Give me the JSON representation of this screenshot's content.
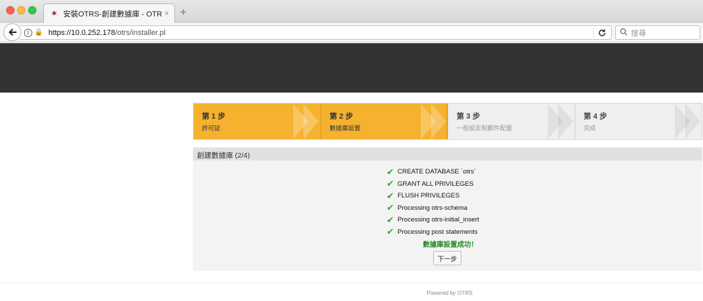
{
  "browser": {
    "tab_title": "安裝OTRS-創建數據庫 - OTRS",
    "tab_close": "×",
    "new_tab": "+",
    "url_host": "https://10.0.252.178",
    "url_path": "/otrs/installer.pl",
    "search_placeholder": "搜尋"
  },
  "wizard": {
    "steps": [
      {
        "num": "第 1 步",
        "label": "許可証",
        "state": "done"
      },
      {
        "num": "第 2 步",
        "label": "數據庫設置",
        "state": "active"
      },
      {
        "num": "第 3 步",
        "label": "一般設定和郵件配置",
        "state": "todo"
      },
      {
        "num": "第 4 步",
        "label": "完成",
        "state": "todo"
      }
    ]
  },
  "panel": {
    "title": "創建數據庫 (2/4)",
    "checklist": [
      "CREATE DATABASE `otrs`",
      "GRANT ALL PRIVILEGES",
      "FLUSH PRIVILEGES",
      "Processing otrs-schema",
      "Processing otrs-initial_insert",
      "Processing post statements"
    ],
    "success_message": "數據庫設置成功！",
    "next_button": "下一步"
  },
  "footer": {
    "text": "Powered by OTRS"
  },
  "colors": {
    "header": "#333333",
    "step_active": "#f5b22f",
    "step_todo": "#efefef",
    "check": "#33a63a",
    "success": "#2e8b2e"
  }
}
